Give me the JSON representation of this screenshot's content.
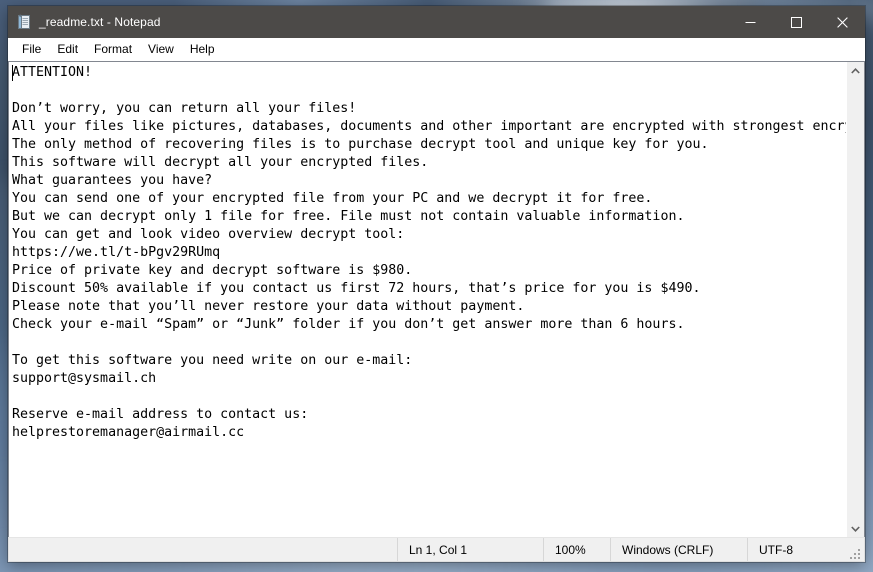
{
  "window": {
    "title": "_readme.txt - Notepad",
    "icon": "notepad-icon",
    "controls": {
      "minimize": "–",
      "maximize": "☐",
      "close": "✕"
    }
  },
  "menu": {
    "items": [
      {
        "label": "File"
      },
      {
        "label": "Edit"
      },
      {
        "label": "Format"
      },
      {
        "label": "View"
      },
      {
        "label": "Help"
      }
    ]
  },
  "editor": {
    "text": "ATTENTION!\n\nDon’t worry, you can return all your files!\nAll your files like pictures, databases, documents and other important are encrypted with strongest encryption and unique key.\nThe only method of recovering files is to purchase decrypt tool and unique key for you.\nThis software will decrypt all your encrypted files.\nWhat guarantees you have?\nYou can send one of your encrypted file from your PC and we decrypt it for free.\nBut we can decrypt only 1 file for free. File must not contain valuable information.\nYou can get and look video overview decrypt tool:\nhttps://we.tl/t-bPgv29RUmq\nPrice of private key and decrypt software is $980.\nDiscount 50% available if you contact us first 72 hours, that’s price for you is $490.\nPlease note that you’ll never restore your data without payment.\nCheck your e-mail “Spam” or “Junk” folder if you don’t get answer more than 6 hours.\n\nTo get this software you need write on our e-mail:\nsupport@sysmail.ch\n\nReserve e-mail address to contact us:\nhelprestoremanager@airmail.cc"
  },
  "scrollbar": {
    "up_arrow": "▲",
    "down_arrow": "▼"
  },
  "status_bar": {
    "line_col": "Ln 1, Col 1",
    "zoom": "100%",
    "line_ending": "Windows (CRLF)",
    "encoding": "UTF-8"
  },
  "colors": {
    "title_bar": "#4c4a48",
    "window_bg": "#ffffff",
    "status_bar": "#f0f0f0",
    "text": "#000000",
    "desktop_accent": "#46607e"
  }
}
